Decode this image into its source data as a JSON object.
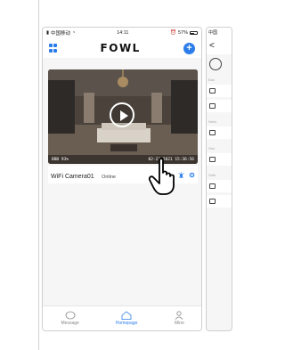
{
  "status_bar": {
    "carrier": "中国移动",
    "time": "14:11",
    "battery_pct": "57%"
  },
  "header": {
    "logo": "FOWL"
  },
  "camera": {
    "overlay_battery": "BBB 93%",
    "overlay_datetime": "02-23-2021 15:36:56",
    "name": "WiFi Camera01",
    "status": "Online"
  },
  "tabbar": {
    "items": [
      {
        "label": "Message"
      },
      {
        "label": "Homepage"
      },
      {
        "label": "Mine"
      }
    ]
  },
  "second_screen": {
    "carrier": "中国",
    "back": "<",
    "sections": [
      "Bas",
      "Netw",
      "Stor",
      "Safe"
    ]
  },
  "colors": {
    "accent": "#2b7de9",
    "background": "#f6f6f6"
  }
}
